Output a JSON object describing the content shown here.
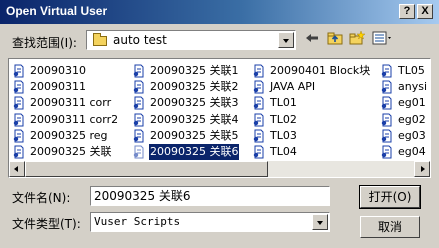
{
  "window": {
    "title": "Open Virtual User",
    "help_button": "?",
    "close_button": "X"
  },
  "lookin": {
    "label": "查找范围(I):",
    "value": "auto test"
  },
  "files": {
    "columns": [
      [
        "20090310",
        "20090311",
        "20090311 corr",
        "20090311 corr2",
        "20090325 reg",
        "20090325 关联"
      ],
      [
        "20090325 关联1",
        "20090325 关联2",
        "20090325 关联3",
        "20090325 关联4",
        "20090325 关联5",
        "20090325 关联6"
      ],
      [
        "20090401 Block块",
        "JAVA API",
        "TL01",
        "TL02",
        "TL03",
        "TL04"
      ],
      [
        "TL05",
        "anysi",
        "eg01",
        "eg02",
        "eg03",
        "eg04"
      ]
    ],
    "selected": "20090325 关联6"
  },
  "filename": {
    "label": "文件名(N):",
    "value": "20090325 关联6"
  },
  "filetype": {
    "label": "文件类型(T):",
    "value": "Vuser Scripts"
  },
  "buttons": {
    "open": "打开(O)",
    "cancel": "取消"
  },
  "colors": {
    "titlebar": "#0a246a",
    "selection": "#0a246a",
    "face": "#d4d0c8"
  }
}
